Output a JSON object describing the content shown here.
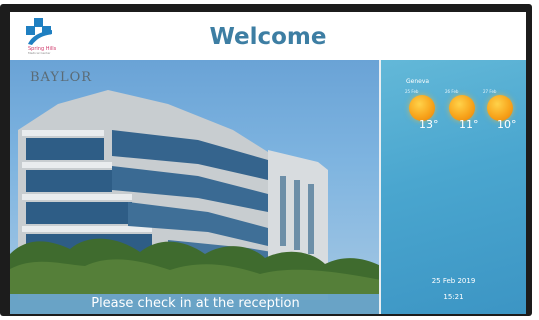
{
  "header": {
    "title": "Welcome",
    "logo_text": "Spring Hills",
    "logo_subtext": "Medical Center"
  },
  "photo": {
    "sign_text": "BAYLOR",
    "banner_text": "Please check in at the reception"
  },
  "weather": {
    "city": "Geneva",
    "days": [
      {
        "date": "25 Feb",
        "temp": "13°",
        "icon": "sun-icon"
      },
      {
        "date": "26 Feb",
        "temp": "11°",
        "icon": "sun-icon"
      },
      {
        "date": "27 Feb",
        "temp": "10°",
        "icon": "sun-icon"
      }
    ]
  },
  "datetime": {
    "date": "25 Feb 2019",
    "time": "15:21"
  },
  "colors": {
    "title": "#3d7ea3",
    "banner": "#64a0c3",
    "side_panel": "#4aa6cf",
    "logo_blue": "#1f7fc1",
    "logo_pink": "#d0386a"
  }
}
